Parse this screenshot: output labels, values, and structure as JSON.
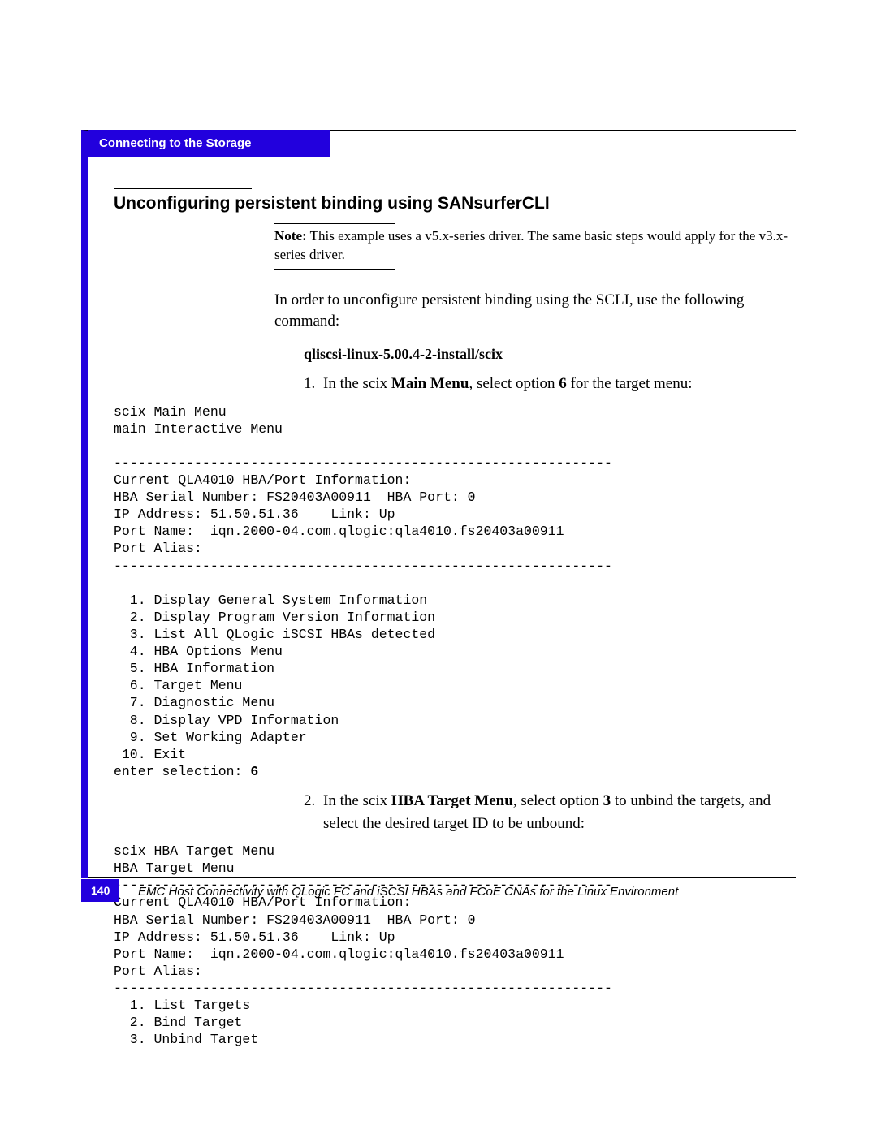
{
  "section_tab": "Connecting to the Storage",
  "title": "Unconfiguring persistent binding using SANsurferCLI",
  "note_label": "Note:",
  "note_text": " This example uses a v5.x-series driver. The same basic steps would apply for the v3.x-series driver.",
  "intro": "In order to unconfigure persistent binding using the SCLI, use the following command:",
  "command": "qliscsi-linux-5.00.4-2-install/scix",
  "step1_pre": "In the scix ",
  "step1_b1": "Main Menu",
  "step1_mid": ", select option ",
  "step1_b2": "6",
  "step1_post": " for the target menu:",
  "terminal1": "scix Main Menu\nmain Interactive Menu\n\n--------------------------------------------------------------\nCurrent QLA4010 HBA/Port Information:\nHBA Serial Number: FS20403A00911  HBA Port: 0\nIP Address: 51.50.51.36    Link: Up\nPort Name:  iqn.2000-04.com.qlogic:qla4010.fs20403a00911\nPort Alias:\n--------------------------------------------------------------\n\n  1. Display General System Information\n  2. Display Program Version Information\n  3. List All QLogic iSCSI HBAs detected\n  4. HBA Options Menu\n  5. HBA Information\n  6. Target Menu\n  7. Diagnostic Menu\n  8. Display VPD Information\n  9. Set Working Adapter\n 10. Exit\nenter selection: ",
  "terminal1_sel": "6",
  "step2_pre": "In the scix ",
  "step2_b1": "HBA Target Menu",
  "step2_mid": ", select option ",
  "step2_b2": "3",
  "step2_post": " to unbind the targets, and select the desired target ID to be unbound:",
  "terminal2": "scix HBA Target Menu\nHBA Target Menu\n--------------------------------------------------------------\nCurrent QLA4010 HBA/Port Information:\nHBA Serial Number: FS20403A00911  HBA Port: 0\nIP Address: 51.50.51.36    Link: Up\nPort Name:  iqn.2000-04.com.qlogic:qla4010.fs20403a00911\nPort Alias:\n--------------------------------------------------------------\n  1. List Targets\n  2. Bind Target\n  3. Unbind Target",
  "page_number": "140",
  "footer_text": "EMC Host Connectivity with QLogic FC and iSCSI HBAs and FCoE CNAs for the Linux Environment"
}
